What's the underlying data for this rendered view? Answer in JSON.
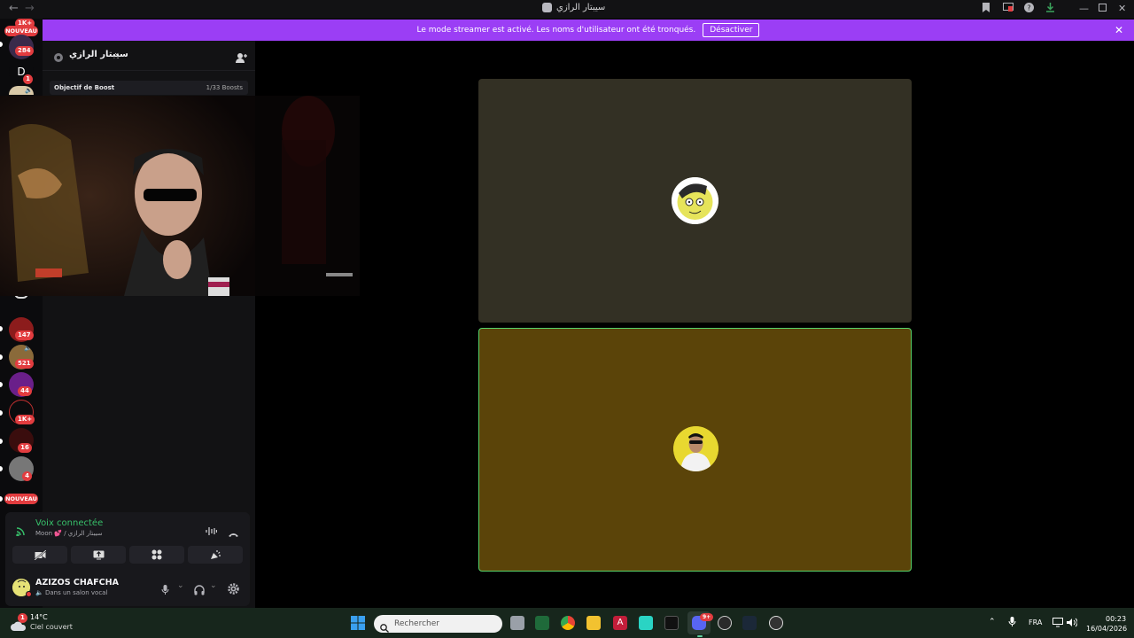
{
  "window": {
    "title": "سيبتار الرازي",
    "nav_back": "←",
    "nav_forward": "→",
    "icons": [
      "bookmark-icon",
      "screen-share-icon",
      "help-icon",
      "download-icon",
      "minimize-icon",
      "maximize-icon",
      "close-icon"
    ]
  },
  "banner": {
    "message": "Le mode streamer est activé. Les noms d'utilisateur ont été tronqués.",
    "button": "Désactiver",
    "close": "✕"
  },
  "rail": {
    "top_badge": "1K+",
    "nouveau_top": "NOUVEAU",
    "nouveau_bottom": "NOUVEAU",
    "servers": [
      {
        "badge": "284"
      },
      {
        "letter": "D",
        "badge": "1"
      },
      {
        "badge": "147"
      },
      {
        "badge": "521"
      },
      {
        "badge": "44"
      },
      {
        "badge": "1K+"
      },
      {
        "badge": "16"
      },
      {
        "badge": "4"
      }
    ]
  },
  "sidebar": {
    "server_name": "سيبتار الرازي",
    "boost_label": "Objectif de Boost",
    "boost_count": "1/33 Boosts"
  },
  "voice": {
    "status": "Voix connectée",
    "channel": "Moon 💕 / سيبتار الرازي"
  },
  "user": {
    "name": "AZIZOS CHAFCHA",
    "status": "Dans un salon vocal"
  },
  "taskbar": {
    "weather_temp": "14°C",
    "weather_desc": "Ciel couvert",
    "weather_badge": "1",
    "search_placeholder": "Rechercher",
    "language": "FRA",
    "time": "00:23",
    "date": "16/04/2026",
    "discord_badge": "9+"
  },
  "colors": {
    "accent_banner": "#9b3ef5",
    "voice_green": "#37c06a",
    "speaking_border": "#57d36b",
    "badge_red": "#e23c3f"
  }
}
